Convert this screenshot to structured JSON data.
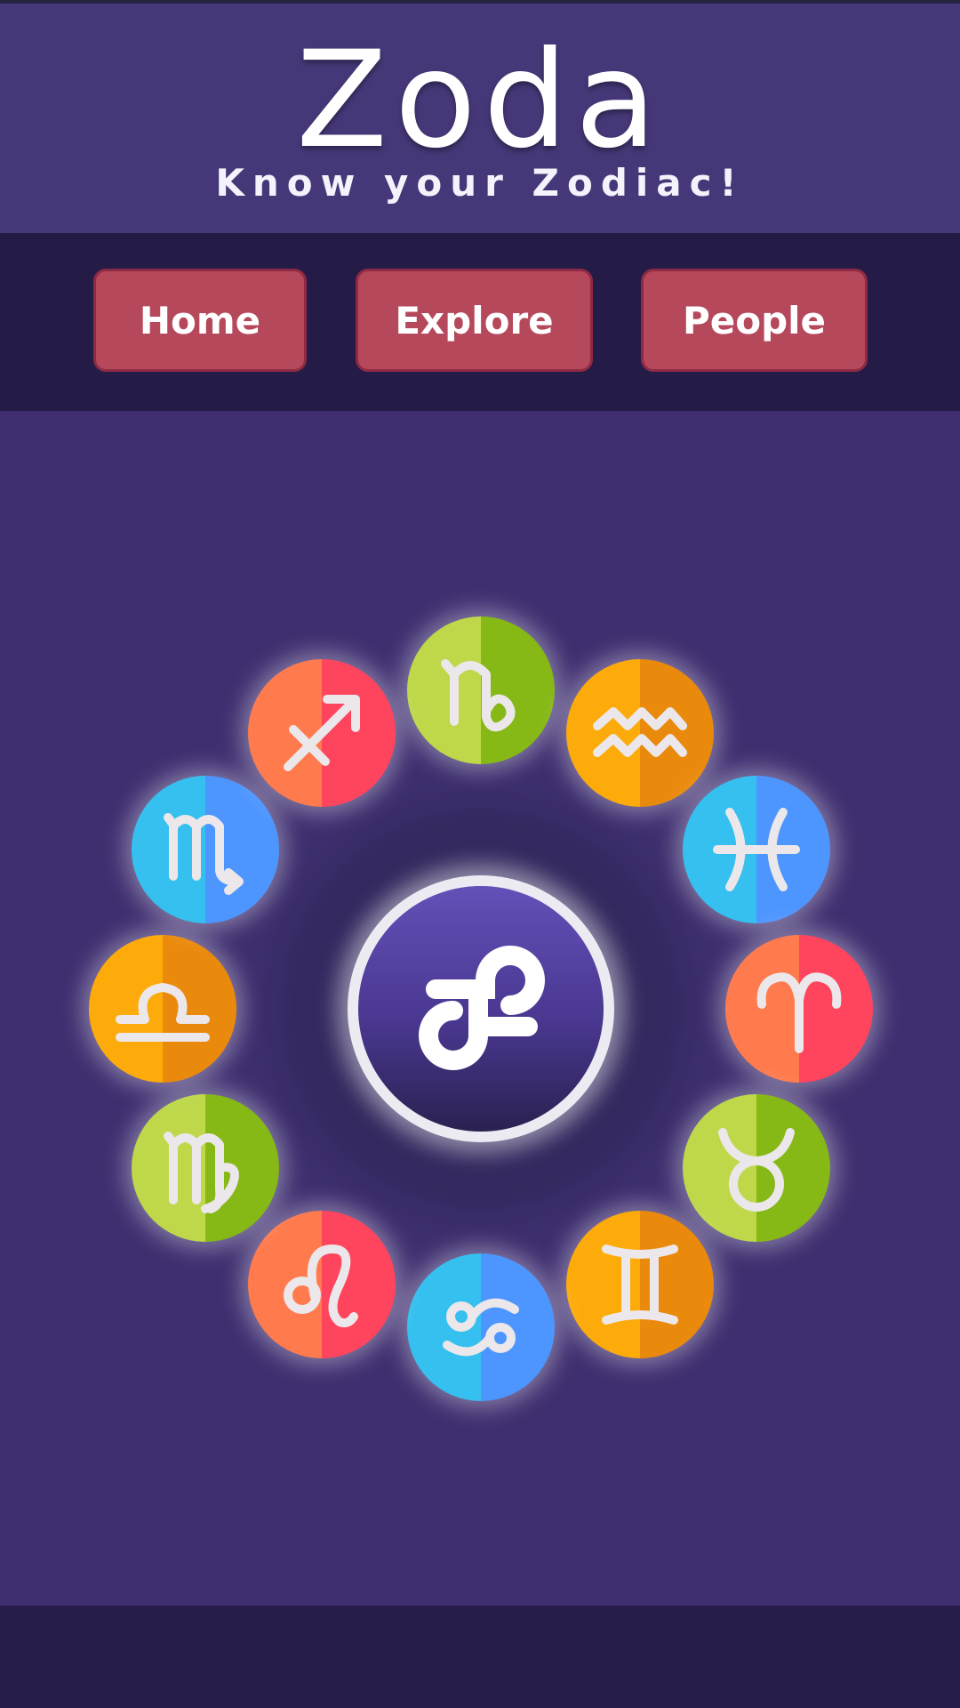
{
  "header": {
    "title": "Zoda",
    "subtitle": "Know your Zodiac!"
  },
  "nav": {
    "items": [
      "Home",
      "Explore",
      "People"
    ]
  },
  "wheel": {
    "center_icon": "zodiac-wheel-icon",
    "signs": [
      {
        "name": "capricorn",
        "icon": "capricorn-icon",
        "colors": [
          "#bed84a",
          "#86b816"
        ]
      },
      {
        "name": "aquarius",
        "icon": "aquarius-icon",
        "colors": [
          "#fdab0b",
          "#ea8a0d"
        ]
      },
      {
        "name": "pisces",
        "icon": "pisces-icon",
        "colors": [
          "#35c0ef",
          "#4e96ff"
        ]
      },
      {
        "name": "aries",
        "icon": "aries-icon",
        "colors": [
          "#ff7b4d",
          "#ff445e"
        ]
      },
      {
        "name": "taurus",
        "icon": "taurus-icon",
        "colors": [
          "#bed84a",
          "#86b816"
        ]
      },
      {
        "name": "gemini",
        "icon": "gemini-icon",
        "colors": [
          "#fdab0b",
          "#ea8a0d"
        ]
      },
      {
        "name": "cancer",
        "icon": "cancer-icon",
        "colors": [
          "#35c0ef",
          "#4e96ff"
        ]
      },
      {
        "name": "leo",
        "icon": "leo-icon",
        "colors": [
          "#ff7b4d",
          "#ff445e"
        ]
      },
      {
        "name": "virgo",
        "icon": "virgo-icon",
        "colors": [
          "#bed84a",
          "#86b816"
        ]
      },
      {
        "name": "libra",
        "icon": "libra-icon",
        "colors": [
          "#fdab0b",
          "#ea8a0d"
        ]
      },
      {
        "name": "scorpio",
        "icon": "scorpio-icon",
        "colors": [
          "#35c0ef",
          "#4e96ff"
        ]
      },
      {
        "name": "sagittarius",
        "icon": "sagittarius-icon",
        "colors": [
          "#ff7b4d",
          "#ff445e"
        ]
      }
    ]
  }
}
